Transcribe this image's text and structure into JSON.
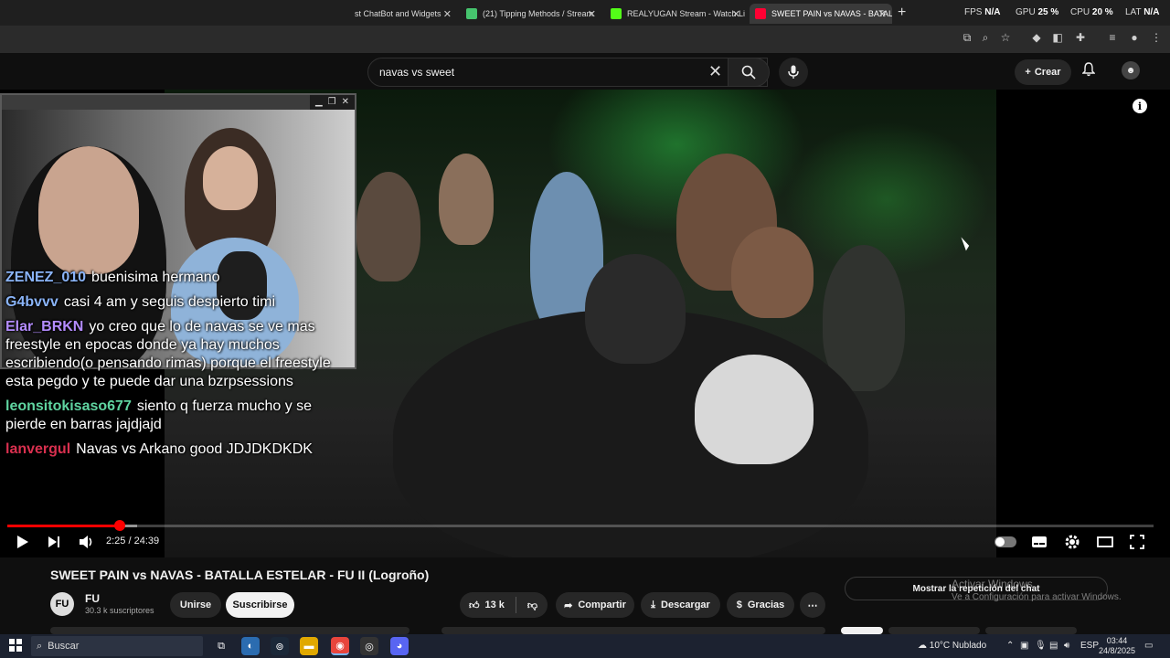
{
  "browser": {
    "tabs": [
      {
        "title": "st ChatBot and Widgets",
        "favicon_color": "#7b5cff",
        "active": false
      },
      {
        "title": "(21) Tipping Methods / Stream",
        "favicon_color": "#46c46e",
        "active": false
      },
      {
        "title": "REALYUGAN Stream - Watch Li",
        "favicon_color": "#53fc18",
        "active": false
      },
      {
        "title": "SWEET PAIN vs NAVAS - BATAL",
        "favicon_color": "#ff0033",
        "active": true
      }
    ],
    "perf": {
      "fps_label": "FPS",
      "fps_value": "N/A",
      "gpu_label": "GPU",
      "gpu_value": "25",
      "cpu_label": "CPU",
      "cpu_value": "20",
      "lat_label": "LAT",
      "lat_value": "N/A"
    }
  },
  "youtube": {
    "search": {
      "query": "navas vs sweet"
    },
    "create_label": "Crear",
    "avatar_icon": "ghost-face-icon"
  },
  "chat": [
    {
      "user": "ZENEZ_010",
      "message": "buenisima hermano",
      "color": "#8ab4f8"
    },
    {
      "user": "G4bvvv",
      "message": "casi 4 am y seguis despierto timi",
      "color": "#8ab4f8"
    },
    {
      "user": "Elar_BRKN",
      "message": "yo creo que lo de navas se ve mas freestyle en epocas donde ya hay muchos escribiendo(o pensando rimas) porque el freestyle esta pegdo y te puede dar una bzrpsessions",
      "color": "#b48cff"
    },
    {
      "user": "leonsitokisaso677",
      "message": "siento q fuerza mucho y se pierde en barras jajdjajd",
      "color": "#5fd4a0"
    },
    {
      "user": "lanvergul",
      "message": "Navas vs Arkano good JDJDKDKDK",
      "color": "#d9304f"
    }
  ],
  "player": {
    "current_time": "2:25",
    "duration": "24:39",
    "time_display": "2:25 / 24:39",
    "progress_fraction": 0.098,
    "loaded_fraction": 0.113
  },
  "video": {
    "title": "SWEET PAIN vs NAVAS - BATALLA ESTELAR - FU II (Logroño)",
    "channel": {
      "name": "FU",
      "subscribers": "30.3 k suscriptores",
      "avatar_text": "FU"
    },
    "buttons": {
      "join": "Unirse",
      "subscribe": "Suscribirse",
      "likes": "13 k",
      "share": "Compartir",
      "download": "Descargar",
      "thanks": "Gracias"
    },
    "chat_replay": "Mostrar la repetición del chat"
  },
  "watermark": {
    "line1": "Activar Windows",
    "line2": "Ve a Configuración para activar Windows."
  },
  "taskbar": {
    "search_placeholder": "Buscar",
    "weather": "10°C  Nublado",
    "lang": "ESP",
    "time": "03:44",
    "date": "24/8/2025"
  }
}
